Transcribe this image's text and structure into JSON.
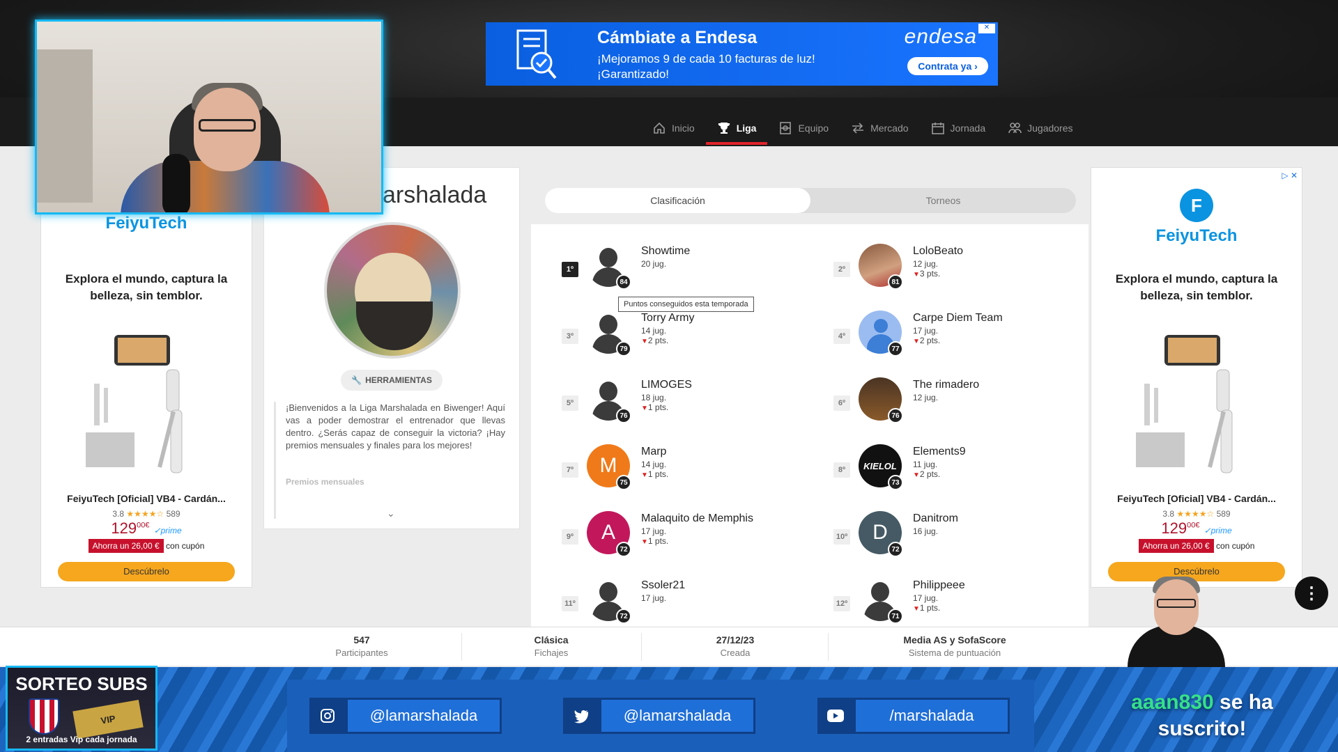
{
  "endesa_ad": {
    "title": "Cámbiate a Endesa",
    "line1": "¡Mejoramos 9 de cada 10 facturas de luz!",
    "line2": "¡Garantizado!",
    "brand": "endesa",
    "cta": "Contrata ya ›"
  },
  "nav": {
    "items": [
      {
        "label": "Inicio",
        "icon": "home-icon"
      },
      {
        "label": "Liga",
        "icon": "trophy-icon",
        "active": true
      },
      {
        "label": "Equipo",
        "icon": "team-icon"
      },
      {
        "label": "Mercado",
        "icon": "transfer-icon"
      },
      {
        "label": "Jornada",
        "icon": "calendar-icon"
      },
      {
        "label": "Jugadores",
        "icon": "players-icon"
      }
    ]
  },
  "ad": {
    "brand": "FeiyuTech",
    "tagline": "Explora el mundo, captura la belleza, sin temblor.",
    "product_name": "FeiyuTech [Oficial] VB4 - Cardán...",
    "rating": "3.8",
    "stars": "★★★★☆",
    "reviews": "589",
    "price_int": "129",
    "price_dec": "00",
    "currency": "€",
    "prime": "✓prime",
    "coupon": "Ahorra un 26,00 €",
    "coupon_suffix": "con cupón",
    "cta": "Descúbrelo"
  },
  "league": {
    "title": "arshalada",
    "tools_label": "HERRAMIENTAS",
    "description": "¡Bienvenidos a la Liga Marshalada en Biwenger! Aquí vas a poder demostrar el entrenador que llevas dentro. ¿Serás capaz de conseguir la victoria? ¡Hay premios mensuales y finales para los mejores!",
    "more": "Premios mensuales"
  },
  "ranking": {
    "tabs": [
      "Clasificación",
      "Torneos"
    ],
    "tooltip": "Puntos conseguidos esta temporada",
    "players": [
      {
        "pos": "1º",
        "name": "Showtime",
        "jug": "20 jug.",
        "pts": "",
        "score": "84",
        "avatar": "silhouette"
      },
      {
        "pos": "2º",
        "name": "LoloBeato",
        "jug": "12 jug.",
        "pts": "3 pts.",
        "score": "81",
        "avatar": "photo"
      },
      {
        "pos": "3º",
        "name": "Torry Army",
        "jug": "14 jug.",
        "pts": "2 pts.",
        "score": "79",
        "avatar": "silhouette"
      },
      {
        "pos": "4º",
        "name": "Carpe Diem Team",
        "jug": "17 jug.",
        "pts": "2 pts.",
        "score": "77",
        "avatar": "default"
      },
      {
        "pos": "5º",
        "name": "LIMOGES",
        "jug": "18 jug.",
        "pts": "1 pts.",
        "score": "76",
        "avatar": "silhouette"
      },
      {
        "pos": "6º",
        "name": "The rimadero",
        "jug": "12 jug.",
        "pts": "",
        "score": "76",
        "avatar": "brown"
      },
      {
        "pos": "7º",
        "name": "Marp",
        "jug": "14 jug.",
        "pts": "1 pts.",
        "score": "75",
        "avatar": "letter",
        "letter": "M",
        "color": "#f07a1a"
      },
      {
        "pos": "8º",
        "name": "Elements9",
        "jug": "11 jug.",
        "pts": "2 pts.",
        "score": "73",
        "avatar": "black",
        "letter": "KIELOL"
      },
      {
        "pos": "9º",
        "name": "Malaquito de Memphis",
        "jug": "17 jug.",
        "pts": "1 pts.",
        "score": "72",
        "avatar": "letter",
        "letter": "A",
        "color": "#c2185b"
      },
      {
        "pos": "10º",
        "name": "Danitrom",
        "jug": "16 jug.",
        "pts": "",
        "score": "72",
        "avatar": "letter",
        "letter": "D",
        "color": "#455a64"
      },
      {
        "pos": "11º",
        "name": "Ssoler21",
        "jug": "17 jug.",
        "pts": "",
        "score": "72",
        "avatar": "silhouette"
      },
      {
        "pos": "12º",
        "name": "Philippeee",
        "jug": "17 jug.",
        "pts": "1 pts.",
        "score": "71",
        "avatar": "silhouette"
      }
    ]
  },
  "stats": [
    {
      "value": "547",
      "label": "Participantes"
    },
    {
      "value": "Clásica",
      "label": "Fichajes"
    },
    {
      "value": "27/12/23",
      "label": "Creada"
    },
    {
      "value": "Media AS y SofaScore",
      "label": "Sistema de puntuación"
    }
  ],
  "stream": {
    "sorteo_title": "SORTEO SUBS",
    "sorteo_ticket": "VIP",
    "sorteo_sub": "2 entradas Vip cada jornada",
    "socials": [
      {
        "icon": "instagram-icon",
        "handle": "@lamarshalada"
      },
      {
        "icon": "twitter-icon",
        "handle": "@lamarshalada"
      },
      {
        "icon": "youtube-icon",
        "handle": "/marshalada"
      }
    ],
    "sub_user": "aaan830",
    "sub_text1": " se ha",
    "sub_text2": "suscrito!"
  },
  "colors": {
    "accent": "#e2242b",
    "overlay": "#16b9f3",
    "feiyu": "#0a93e0"
  }
}
